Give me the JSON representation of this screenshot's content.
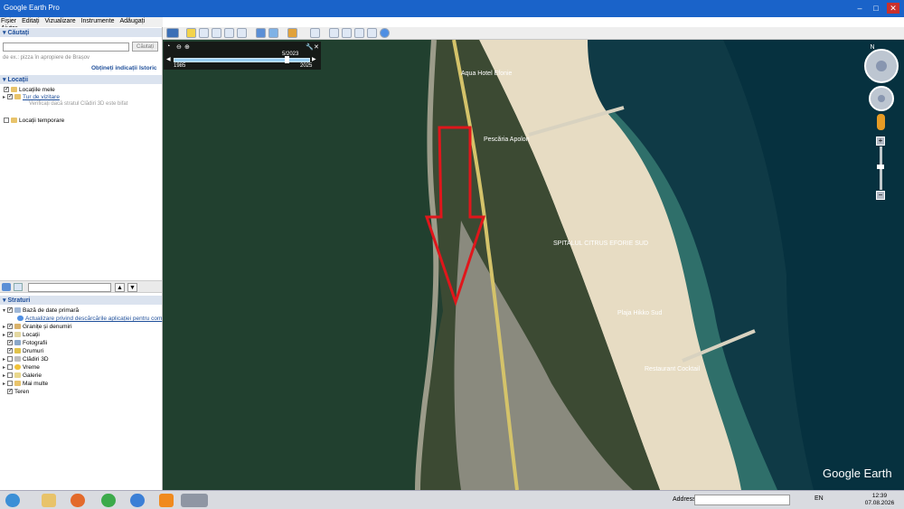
{
  "window": {
    "title": "Google Earth Pro",
    "minimize": "–",
    "maximize": "□",
    "close": "✕"
  },
  "menu": [
    "Fișier",
    "Editați",
    "Vizualizare",
    "Instrumente",
    "Adăugați",
    "Ajutor"
  ],
  "search": {
    "header": "Căutați",
    "placeholder": "",
    "button_label": "Căutați",
    "hint": "de ex.: pizza în apropiere de Brașov",
    "directions_link": "Obțineți indicații",
    "history_link": "Istoric"
  },
  "places": {
    "header": "Locații",
    "items": [
      {
        "label": "Locațiile mele"
      },
      {
        "label": "Tur de vizitare"
      },
      {
        "label": "Verificați dacă stratul Clădiri 3D este bifat"
      },
      {
        "label": "Locații temporare"
      }
    ]
  },
  "layers": {
    "header": "Straturi",
    "items": [
      {
        "label": "Bază de date primară"
      },
      {
        "label": "Actualizare privind descărcările aplicației pentru com"
      },
      {
        "label": "Granițe și denumiri"
      },
      {
        "label": "Locații"
      },
      {
        "label": "Fotografii"
      },
      {
        "label": "Drumuri"
      },
      {
        "label": "Clădiri 3D"
      },
      {
        "label": "Vreme"
      },
      {
        "label": "Galerie"
      },
      {
        "label": "Mai multe"
      },
      {
        "label": "Teren"
      }
    ]
  },
  "timeline": {
    "current": "5/2023",
    "start": "1985",
    "end": "2025",
    "position": 0.83
  },
  "map_labels": [
    "Aqua Hotel Efonie",
    "Pescăria Apolon",
    "SPITALUL CITRUS EFORIE SUD",
    "Plaja Hikko Sud",
    "Restaurant Cocktail"
  ],
  "compass": {
    "north": "N"
  },
  "watermark": "Google Earth",
  "taskbar": {
    "address_label": "Address",
    "language": "EN",
    "time": "12:39",
    "date": "07.08.2026"
  }
}
